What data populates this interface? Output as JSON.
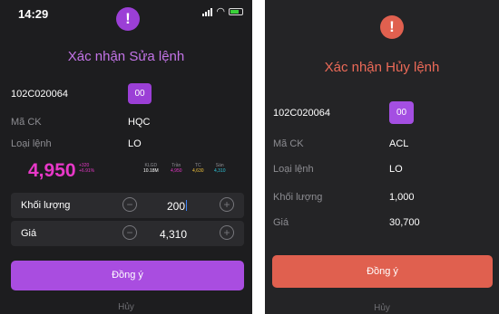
{
  "left_screen": {
    "status_time": "14:29",
    "alert_glyph": "!",
    "title": "Xác nhận Sửa lệnh",
    "account_id": "102C020064",
    "account_badge": "00",
    "symbol_label": "Mã CK",
    "symbol_value": "HQC",
    "order_type_label": "Loại lệnh",
    "order_type_value": "LO",
    "last_price": "4,950",
    "change_abs": "+320",
    "change_pct": "+6.91%",
    "ref_headers": [
      "KLGD",
      "Trần",
      "TC",
      "Sàn"
    ],
    "ref_values": [
      "10.18M",
      "4,950",
      "4,630",
      "4,310"
    ],
    "ref_colors": [
      "#ffffff",
      "#e838c8",
      "#f0c23a",
      "#2ec4d8"
    ],
    "quantity_label": "Khối lượng",
    "quantity_value": "200",
    "price_label": "Giá",
    "price_value": "4,310",
    "minus_glyph": "−",
    "plus_glyph": "+",
    "confirm_label": "Đồng ý",
    "cancel_label": "Hủy"
  },
  "right_screen": {
    "alert_glyph": "!",
    "title": "Xác nhận Hủy lệnh",
    "account_id": "102C020064",
    "account_badge": "00",
    "symbol_label": "Mã CK",
    "symbol_value": "ACL",
    "order_type_label": "Loại lệnh",
    "order_type_value": "LO",
    "quantity_label": "Khối lượng",
    "quantity_value": "1,000",
    "price_label": "Giá",
    "price_value": "30,700",
    "confirm_label": "Đồng ý",
    "cancel_label": "Hủy"
  }
}
